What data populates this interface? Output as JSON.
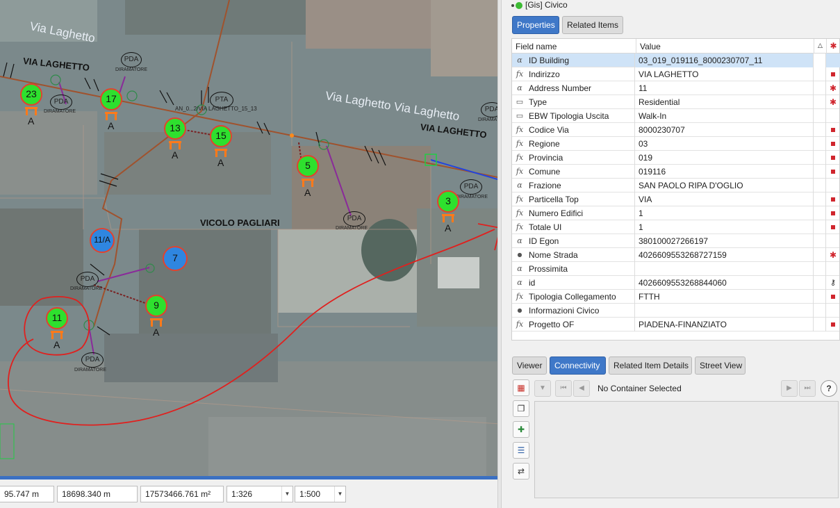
{
  "map": {
    "street_labels": [
      {
        "text": "Via Laghetto"
      },
      {
        "text": "VIA LAGHETTO"
      },
      {
        "text": "Via Laghetto Via Laghetto"
      },
      {
        "text": "VIA LAGHETTO"
      },
      {
        "text": "VICOLO PAGLIARI"
      }
    ],
    "civic_markers": [
      {
        "number": "23",
        "color": "green"
      },
      {
        "number": "17",
        "color": "green"
      },
      {
        "number": "13",
        "color": "green"
      },
      {
        "number": "15",
        "color": "green"
      },
      {
        "number": "5",
        "color": "green"
      },
      {
        "number": "3",
        "color": "green"
      },
      {
        "number": "11/A",
        "color": "blue"
      },
      {
        "number": "7",
        "color": "blue"
      },
      {
        "number": "9",
        "color": "green"
      },
      {
        "number": "11",
        "color": "green"
      }
    ],
    "access_letter": "A",
    "pda_label": "PDA",
    "pta_label": "PTA",
    "diramatore_label": "DIRAMATORE",
    "cable_label": "AN_0...2/VIA LAGHETTO_15_13",
    "colors": {
      "green_marker": "#2ee02e",
      "blue_marker": "#2f86e0",
      "marker_ring": "#e2422e",
      "cable": "#a0522d",
      "annotation": "#e0201e"
    }
  },
  "statusbar": {
    "x_coord": "95.747 m",
    "y_coord": "18698.340 m",
    "area": "17573466.761 m²",
    "scale1": "1:326",
    "scale2": "1:500"
  },
  "panel": {
    "title": "[Gis] Civico",
    "tabs": [
      {
        "label": "Properties",
        "active": true
      },
      {
        "label": "Related Items",
        "active": false
      }
    ],
    "table_headers": {
      "field": "Field name",
      "value": "Value"
    },
    "rows": [
      {
        "icon": "alpha",
        "name": "ID Building",
        "value": "03_019_019116_8000230707_11",
        "req": "",
        "selected": true
      },
      {
        "icon": "fx",
        "name": "Indirizzo",
        "value": "VIA LAGHETTO",
        "req": "box"
      },
      {
        "icon": "alpha",
        "name": "Address Number",
        "value": "11",
        "req": "star"
      },
      {
        "icon": "list",
        "name": "Type",
        "value": "Residential",
        "req": "star"
      },
      {
        "icon": "list",
        "name": "EBW Tipologia Uscita",
        "value": "Walk-In",
        "req": ""
      },
      {
        "icon": "fx",
        "name": "Codice Via",
        "value": "8000230707",
        "req": "box"
      },
      {
        "icon": "fx",
        "name": "Regione",
        "value": "03",
        "req": "box"
      },
      {
        "icon": "fx",
        "name": "Provincia",
        "value": "019",
        "req": "box"
      },
      {
        "icon": "fx",
        "name": "Comune",
        "value": "019116",
        "req": "box"
      },
      {
        "icon": "alpha",
        "name": "Frazione",
        "value": "SAN PAOLO RIPA D'OGLIO",
        "req": ""
      },
      {
        "icon": "fx",
        "name": "Particella Top",
        "value": "VIA",
        "req": "box"
      },
      {
        "icon": "fx",
        "name": "Numero Edifici",
        "value": "1",
        "req": "box"
      },
      {
        "icon": "fx",
        "name": "Totale UI",
        "value": "1",
        "req": "box"
      },
      {
        "icon": "alpha",
        "name": "ID Egon",
        "value": "380100027266197",
        "req": ""
      },
      {
        "icon": "dot",
        "name": "Nome Strada",
        "value": "4026609553268727159",
        "req": "star"
      },
      {
        "icon": "alpha",
        "name": "Prossimita",
        "value": "",
        "req": ""
      },
      {
        "icon": "alpha",
        "name": "id",
        "value": "4026609553268844060",
        "req": "key"
      },
      {
        "icon": "fx",
        "name": "Tipologia Collegamento",
        "value": "FTTH",
        "req": "box"
      },
      {
        "icon": "dot",
        "name": "Informazioni Civico",
        "value": "",
        "req": ""
      },
      {
        "icon": "fx",
        "name": "Progetto OF",
        "value": "PIADENA-FINANZIATO",
        "req": "box"
      }
    ],
    "lower_tabs": [
      {
        "label": "Viewer",
        "active": false
      },
      {
        "label": "Connectivity",
        "active": true
      },
      {
        "label": "Related Item Details",
        "active": false
      },
      {
        "label": "Street View",
        "active": false
      }
    ],
    "container_status": "No Container Selected"
  }
}
